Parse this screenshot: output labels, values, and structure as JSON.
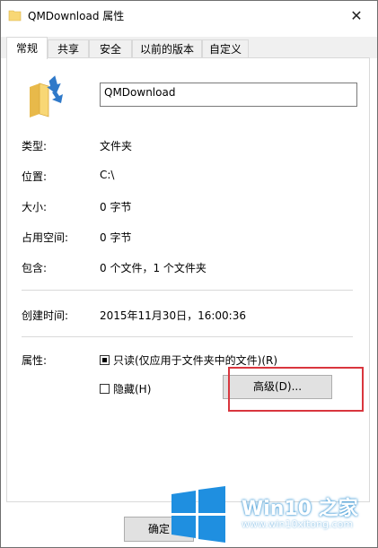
{
  "window": {
    "title": "QMDownload 属性",
    "close_glyph": "✕"
  },
  "tabs": [
    {
      "label": "常规",
      "active": true
    },
    {
      "label": "共享",
      "active": false
    },
    {
      "label": "安全",
      "active": false
    },
    {
      "label": "以前的版本",
      "active": false
    },
    {
      "label": "自定义",
      "active": false
    }
  ],
  "general": {
    "folder_icon": "folder-icon",
    "name_value": "QMDownload",
    "rows": [
      {
        "label": "类型:",
        "value": "文件夹"
      },
      {
        "label": "位置:",
        "value": "C:\\"
      },
      {
        "label": "大小:",
        "value": "0 字节"
      },
      {
        "label": "占用空间:",
        "value": "0 字节"
      },
      {
        "label": "包含:",
        "value": "0 个文件，1 个文件夹"
      }
    ],
    "created_label": "创建时间:",
    "created_value": "2015年11月30日，16:00:36",
    "attributes_label": "属性:",
    "readonly_label": "只读(仅应用于文件夹中的文件)(R)",
    "readonly_state": "indeterminate",
    "hidden_label": "隐藏(H)",
    "hidden_checked": false,
    "advanced_button": "高级(D)..."
  },
  "footer": {
    "ok_button": "确定"
  },
  "watermark": {
    "brand": "Win10 之家",
    "url": "www.win10xitong.com"
  },
  "colors": {
    "highlight": "#d9363e",
    "folder": "#f8d775",
    "win_logo": "#1f8fe0"
  }
}
